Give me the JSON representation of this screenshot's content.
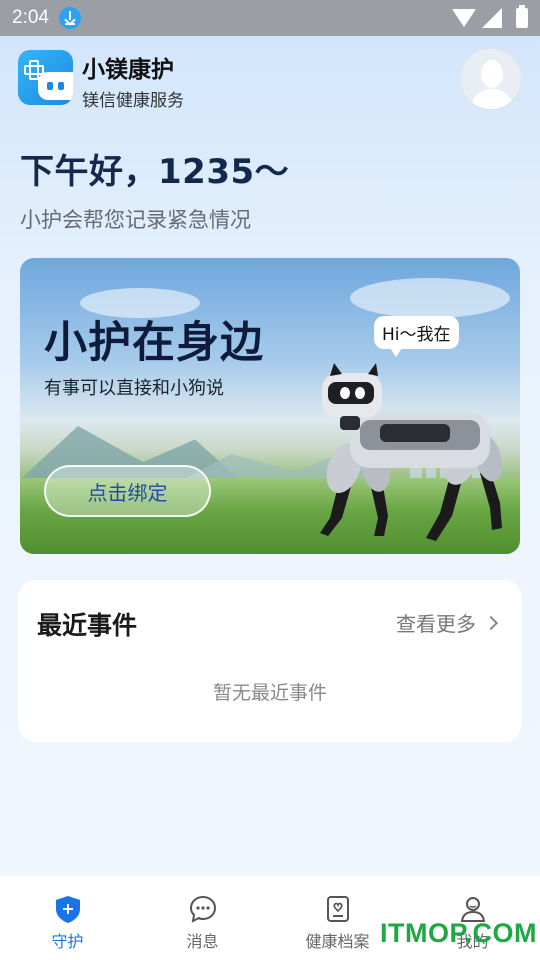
{
  "status_bar": {
    "time": "2:04"
  },
  "header": {
    "app_name": "小镁康护",
    "app_subtitle": "镁信健康服务"
  },
  "greeting": {
    "title": "下午好，1235～",
    "subtitle": "小护会帮您记录紧急情况"
  },
  "banner": {
    "title": "小护在身边",
    "description": "有事可以直接和小狗说",
    "bind_button_label": "点击绑定",
    "speech_bubble": "Hi～我在"
  },
  "recent_events": {
    "title": "最近事件",
    "see_more_label": "查看更多",
    "empty_text": "暂无最近事件"
  },
  "bottom_nav": {
    "items": [
      {
        "label": "守护",
        "icon": "shield-plus-icon",
        "active": true
      },
      {
        "label": "消息",
        "icon": "chat-bubble-icon",
        "active": false
      },
      {
        "label": "健康档案",
        "icon": "health-record-icon",
        "active": false
      },
      {
        "label": "我的",
        "icon": "user-icon",
        "active": false
      }
    ]
  },
  "watermark": "ITMOP.COM",
  "colors": {
    "accent": "#1a73e8",
    "title_dark": "#14284b",
    "watermark_green": "#1ea844"
  }
}
